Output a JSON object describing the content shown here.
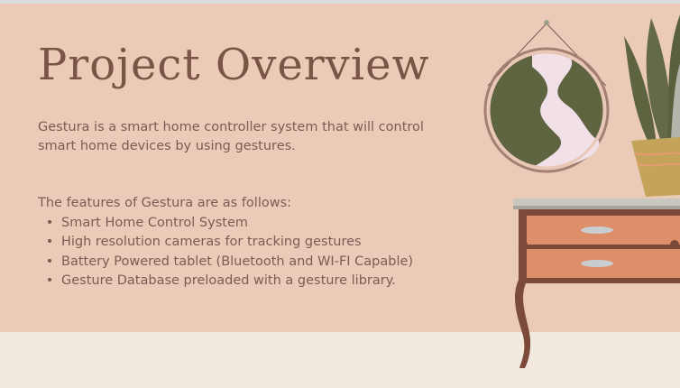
{
  "slide": {
    "title": "Project Overview",
    "intro": "Gestura is a smart home controller system that will control smart home devices by using gestures.",
    "features_title": "The features of Gestura are as follows:",
    "features": [
      "Smart Home Control System",
      "High resolution cameras for tracking gestures",
      "Battery Powered tablet (Bluetooth and WI-FI Capable)",
      "Gesture Database preloaded with a gesture library."
    ]
  },
  "colors": {
    "wall": "#ebcbb8",
    "floor": "#f2e9df",
    "title": "#7a5545",
    "body_text": "#7a5c54"
  }
}
